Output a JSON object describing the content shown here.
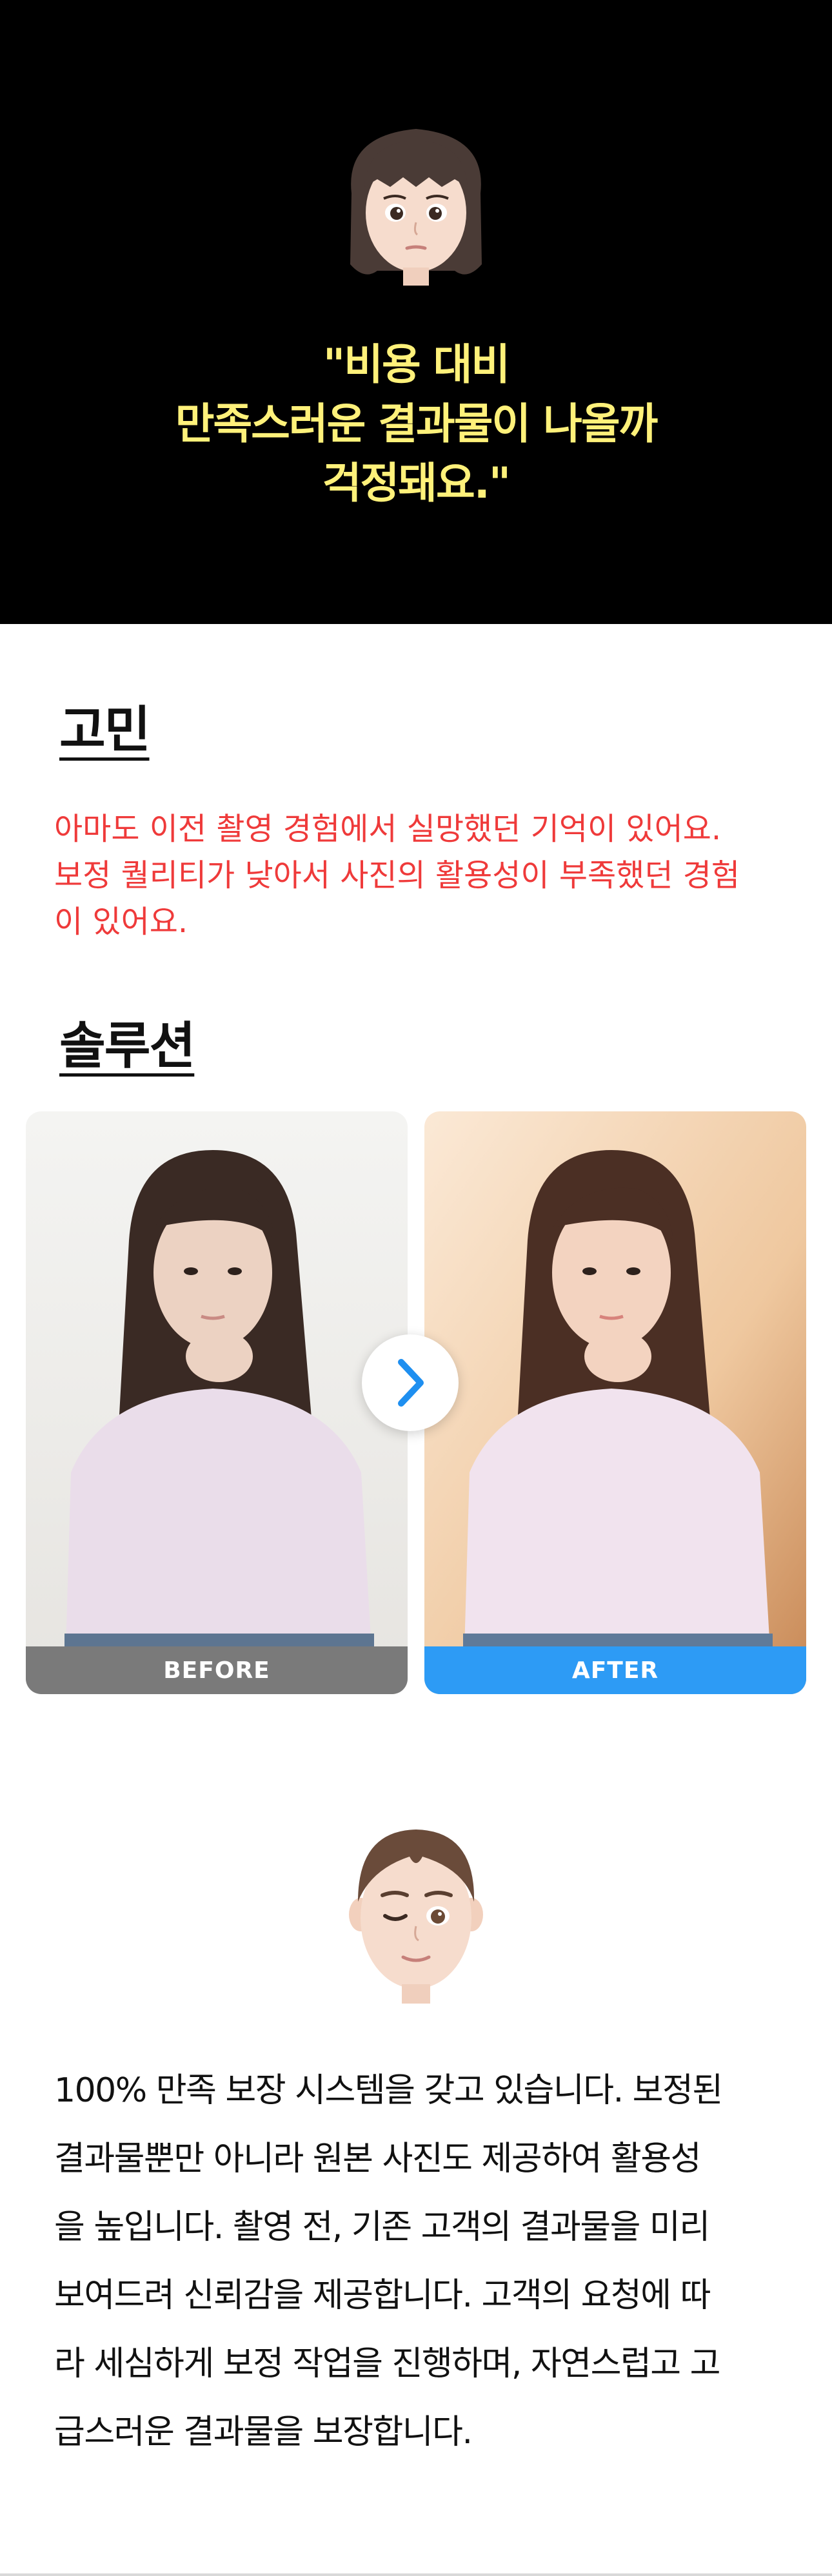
{
  "hero": {
    "quote_lines": [
      "\"비용 대비",
      "만족스러운 결과물이 나올까",
      "걱정돼요.\""
    ],
    "avatar_icon": "girl-avatar-icon"
  },
  "worry": {
    "title": "고민",
    "lines": [
      "아마도 이전 촬영 경험에서 실망했던 기억이 있어요.",
      "보정 퀄리티가 낮아서 사진의 활용성이 부족했던 경험",
      "이 있어요."
    ]
  },
  "solution": {
    "title": "솔루션",
    "before_label": "BEFORE",
    "after_label": "AFTER",
    "arrow_icon": "chevron-right-icon",
    "avatar_icon": "winking-man-avatar-icon",
    "lines": [
      "100% 만족 보장 시스템을 갖고 있습니다. 보정된",
      "결과물뿐만 아니라 원본 사진도 제공하여 활용성",
      "을 높입니다. 촬영 전, 기존 고객의 결과물을 미리",
      "보여드려 신뢰감을 제공합니다. 고객의 요청에 따",
      "라 세심하게 보정 작업을 진행하며, 자연스럽고 고",
      "급스러운 결과물을 보장합니다."
    ]
  },
  "colors": {
    "hero_bg": "#000000",
    "quote_yellow": "#fff17a",
    "worry_red": "#ef3a3a",
    "before_gray": "#7a7a7a",
    "after_blue": "#2d9bf5"
  }
}
